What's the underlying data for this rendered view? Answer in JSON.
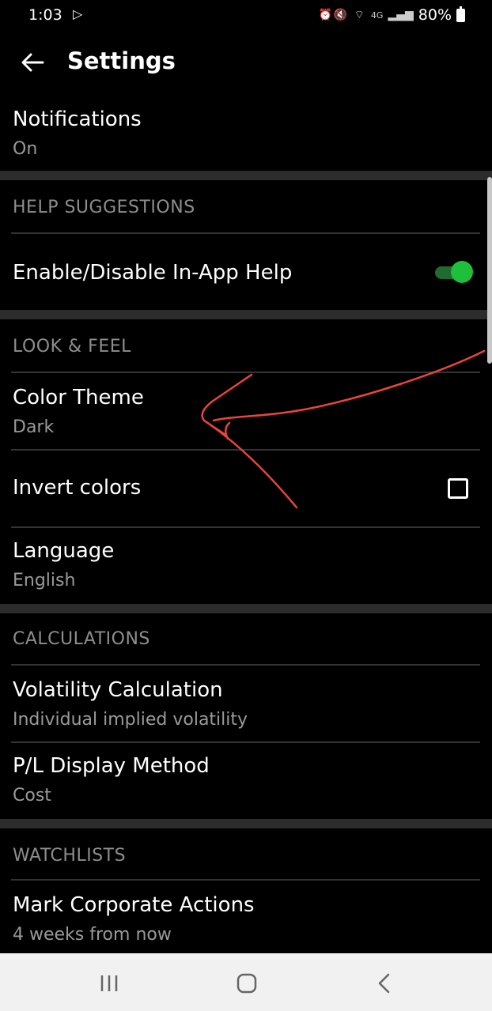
{
  "status_bar": {
    "time": "1:03",
    "network": "4G",
    "battery": "80%"
  },
  "app_bar": {
    "title": "Settings",
    "back_icon": "arrow-left-icon"
  },
  "items": {
    "notifications": {
      "title": "Notifications",
      "value": "On"
    },
    "in_app_help": {
      "title": "Enable/Disable In-App Help",
      "enabled": true
    },
    "color_theme": {
      "title": "Color Theme",
      "value": "Dark"
    },
    "invert_colors": {
      "title": "Invert colors",
      "checked": false
    },
    "language": {
      "title": "Language",
      "value": "English"
    },
    "volatility": {
      "title": "Volatility Calculation",
      "value": "Individual implied volatility"
    },
    "pl_display": {
      "title": "P/L Display Method",
      "value": "Cost"
    },
    "corporate_actions": {
      "title": "Mark Corporate Actions",
      "value": "4 weeks from now"
    }
  },
  "sections": {
    "help": "HELP SUGGESTIONS",
    "look": "LOOK & FEEL",
    "calculations": "CALCULATIONS",
    "watchlists": "WATCHLISTS"
  },
  "colors": {
    "background": "#000000",
    "toggle_on": "#1ebf3a",
    "annotation_stroke": "#e8453c",
    "nav_bar": "#f1f1f1"
  },
  "nav_bar": {
    "recents_icon": "recents-icon",
    "home_icon": "home-icon",
    "back_icon": "chevron-left-icon"
  }
}
